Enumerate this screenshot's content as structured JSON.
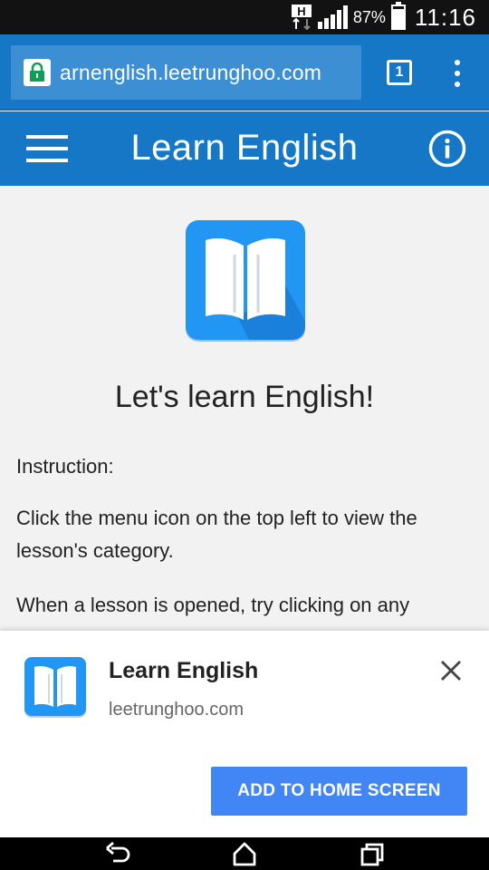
{
  "status_bar": {
    "network_type": "H",
    "battery_percent": "87%",
    "battery_level": 0.87,
    "time": "11:16"
  },
  "browser": {
    "url": "arnenglish.leetrunghoo.com",
    "tab_count": "1"
  },
  "app_header": {
    "title": "Learn English"
  },
  "main": {
    "headline": "Let's learn English!",
    "instruction_label": "Instruction:",
    "paragraph_1": "Click the menu icon on the top left to view the lesson's category.",
    "paragraph_2": "When a lesson is opened, try clicking on any"
  },
  "banner": {
    "app_name": "Learn English",
    "site": "leetrunghoo.com",
    "add_button_label": "ADD TO HOME SCREEN"
  },
  "colors": {
    "primary": "#1677c7",
    "logo_blue": "#2196f3",
    "button_blue": "#4285f4"
  }
}
